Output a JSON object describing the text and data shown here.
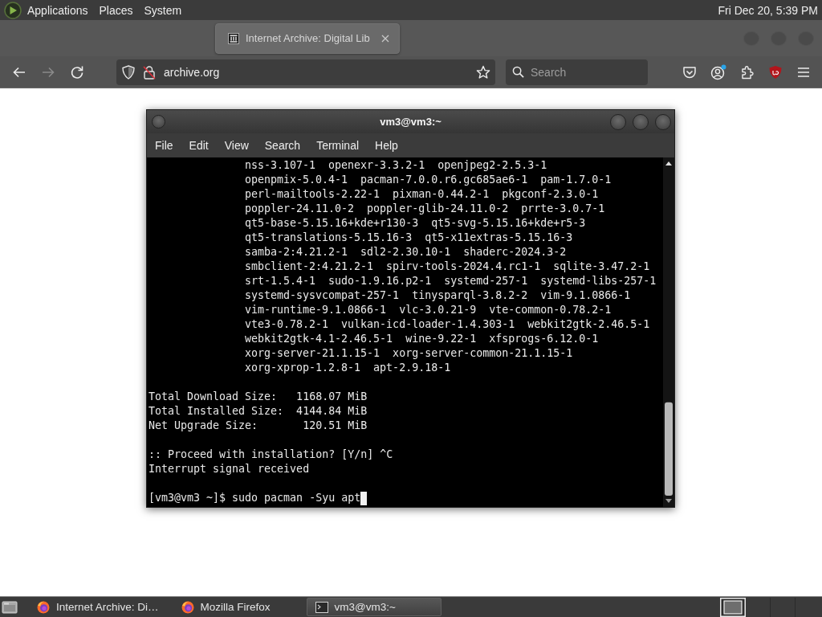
{
  "top_panel": {
    "menus": [
      "Applications",
      "Places",
      "System"
    ],
    "clock": "Fri Dec 20, 5:39 PM"
  },
  "browser": {
    "tabs": [
      {
        "title": "Internet Archive: Digital Lib",
        "selected": true
      }
    ],
    "url": "archive.org",
    "search": {
      "placeholder": "Search"
    }
  },
  "terminal": {
    "title": "vm3@vm3:~",
    "menu": [
      "File",
      "Edit",
      "View",
      "Search",
      "Terminal",
      "Help"
    ],
    "lines": [
      {
        "kind": "package",
        "text": "nss-3.107-1  openexr-3.3.2-1  openjpeg2-2.5.3-1"
      },
      {
        "kind": "package",
        "text": "openpmix-5.0.4-1  pacman-7.0.0.r6.gc685ae6-1  pam-1.7.0-1"
      },
      {
        "kind": "package",
        "text": "perl-mailtools-2.22-1  pixman-0.44.2-1  pkgconf-2.3.0-1"
      },
      {
        "kind": "package",
        "text": "poppler-24.11.0-2  poppler-glib-24.11.0-2  prrte-3.0.7-1"
      },
      {
        "kind": "package",
        "text": "qt5-base-5.15.16+kde+r130-3  qt5-svg-5.15.16+kde+r5-3"
      },
      {
        "kind": "package",
        "text": "qt5-translations-5.15.16-3  qt5-x11extras-5.15.16-3"
      },
      {
        "kind": "package",
        "text": "samba-2:4.21.2-1  sdl2-2.30.10-1  shaderc-2024.3-2"
      },
      {
        "kind": "package",
        "text": "smbclient-2:4.21.2-1  spirv-tools-2024.4.rc1-1  sqlite-3.47.2-1"
      },
      {
        "kind": "package",
        "text": "srt-1.5.4-1  sudo-1.9.16.p2-1  systemd-257-1  systemd-libs-257-1"
      },
      {
        "kind": "package",
        "text": "systemd-sysvcompat-257-1  tinysparql-3.8.2-2  vim-9.1.0866-1"
      },
      {
        "kind": "package",
        "text": "vim-runtime-9.1.0866-1  vlc-3.0.21-9  vte-common-0.78.2-1"
      },
      {
        "kind": "package",
        "text": "vte3-0.78.2-1  vulkan-icd-loader-1.4.303-1  webkit2gtk-2.46.5-1"
      },
      {
        "kind": "package",
        "text": "webkit2gtk-4.1-2.46.5-1  wine-9.22-1  xfsprogs-6.12.0-1"
      },
      {
        "kind": "package",
        "text": "xorg-server-21.1.15-1  xorg-server-common-21.1.15-1"
      },
      {
        "kind": "package",
        "text": "xorg-xprop-1.2.8-1  apt-2.9.18-1"
      },
      {
        "kind": "blank"
      },
      {
        "kind": "output",
        "text": "Total Download Size:   1168.07 MiB"
      },
      {
        "kind": "output",
        "text": "Total Installed Size:  4144.84 MiB"
      },
      {
        "kind": "output",
        "text": "Net Upgrade Size:       120.51 MiB"
      },
      {
        "kind": "blank"
      },
      {
        "kind": "output",
        "text": ":: Proceed with installation? [Y/n] ^C"
      },
      {
        "kind": "output",
        "text": "Interrupt signal received"
      },
      {
        "kind": "blank"
      },
      {
        "kind": "prompt",
        "text": "[vm3@vm3 ~]$ sudo pacman -Syu apt"
      }
    ]
  },
  "taskbar": {
    "items": [
      {
        "kind": "browser",
        "label": "Internet Archive: Di…",
        "selected": false
      },
      {
        "kind": "browser",
        "label": "Mozilla Firefox",
        "selected": false
      },
      {
        "kind": "terminal",
        "label": "vm3@vm3:~",
        "selected": true
      }
    ]
  }
}
